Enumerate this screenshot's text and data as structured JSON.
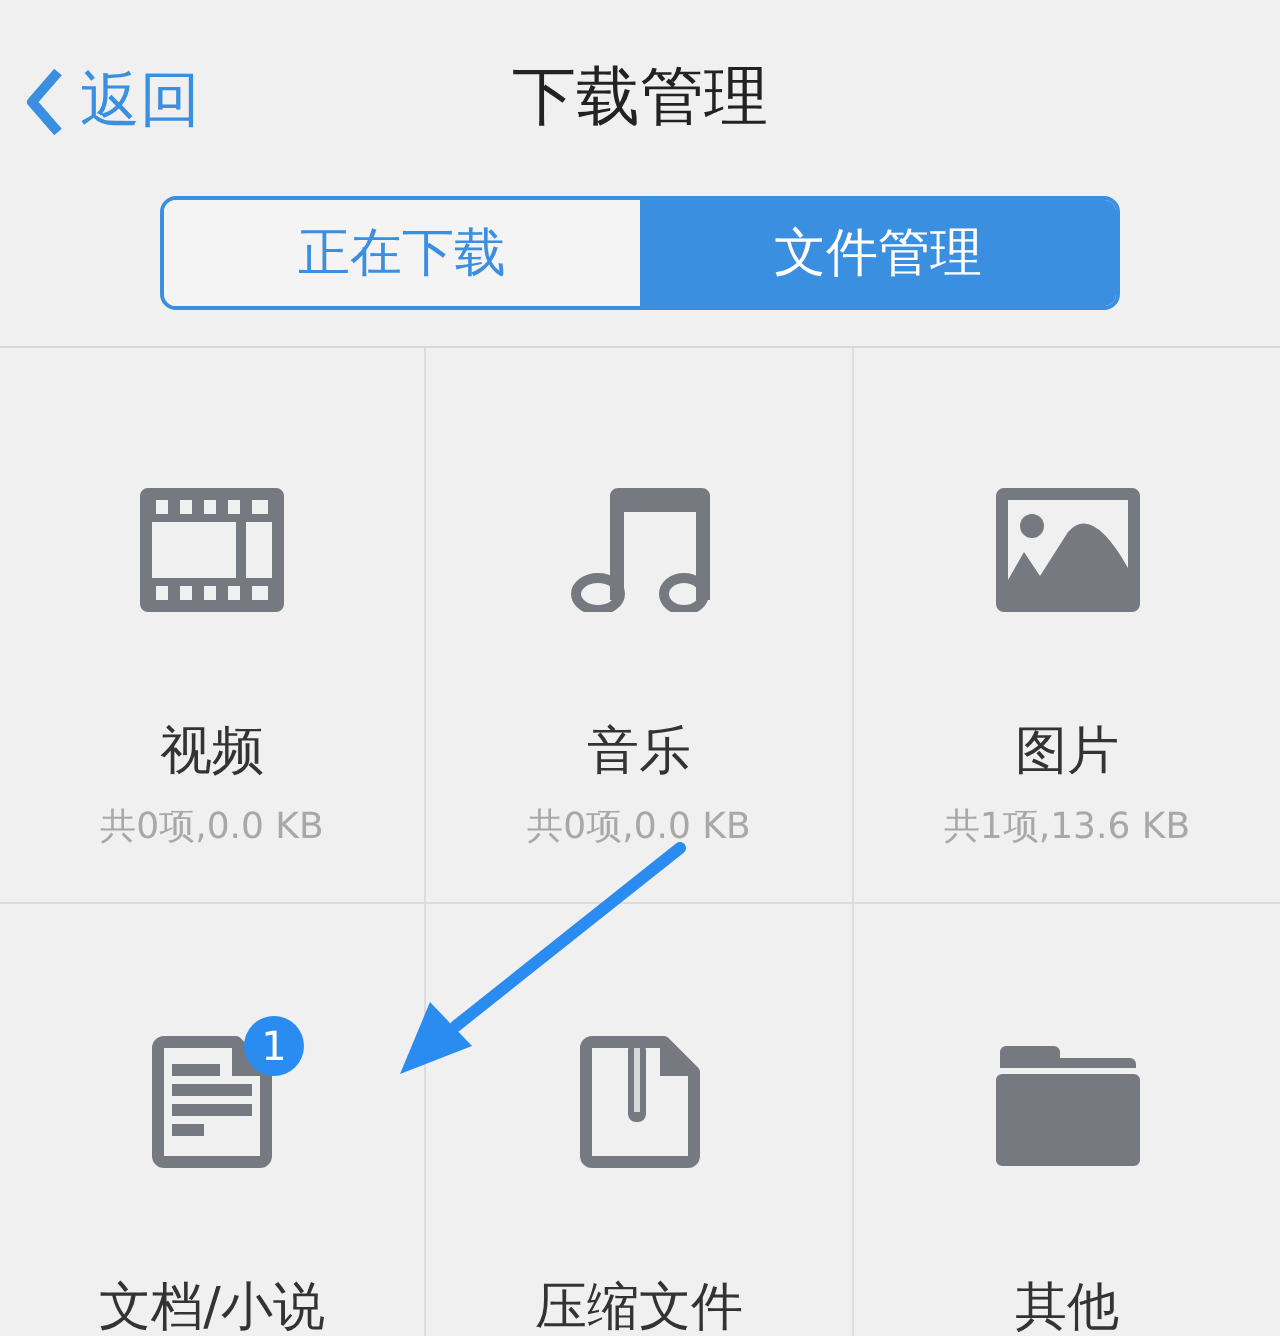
{
  "nav": {
    "back": "返回",
    "title": "下载管理"
  },
  "segments": [
    {
      "label": "正在下载",
      "selected": false
    },
    {
      "label": "文件管理",
      "selected": true
    }
  ],
  "categories": [
    {
      "kind": "video",
      "label": "视频",
      "subtitle": "共0项,0.0 KB"
    },
    {
      "kind": "music",
      "label": "音乐",
      "subtitle": "共0项,0.0 KB"
    },
    {
      "kind": "image",
      "label": "图片",
      "subtitle": "共1项,13.6 KB"
    },
    {
      "kind": "document",
      "label": "文档/小说",
      "badge": "1"
    },
    {
      "kind": "archive",
      "label": "压缩文件"
    },
    {
      "kind": "folder",
      "label": "其他"
    }
  ],
  "annotation": {
    "kind": "arrow"
  }
}
